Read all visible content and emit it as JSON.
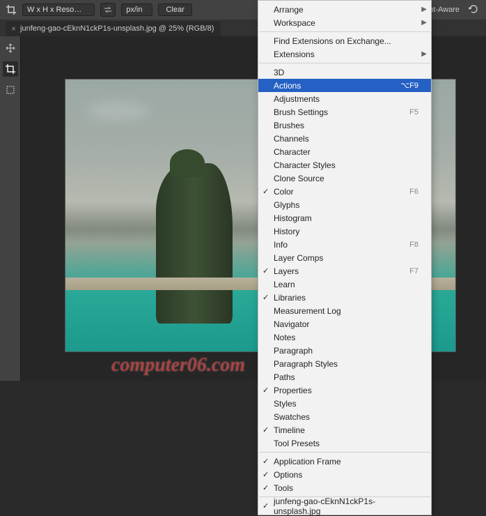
{
  "toolbar": {
    "preset": "W x H x Reso…",
    "units": "px/in",
    "clear": "Clear",
    "content_aware": "ontent-Aware"
  },
  "tab": {
    "title": "junfeng-gao-cEknN1ckP1s-unsplash.jpg @ 25% (RGB/8)"
  },
  "menu": {
    "groups": [
      [
        {
          "label": "Arrange",
          "submenu": true
        },
        {
          "label": "Workspace",
          "submenu": true
        }
      ],
      [
        {
          "label": "Find Extensions on Exchange..."
        },
        {
          "label": "Extensions",
          "submenu": true
        }
      ],
      [
        {
          "label": "3D"
        },
        {
          "label": "Actions",
          "shortcut": "⌥F9",
          "highlight": true
        },
        {
          "label": "Adjustments"
        },
        {
          "label": "Brush Settings",
          "shortcut": "F5"
        },
        {
          "label": "Brushes"
        },
        {
          "label": "Channels"
        },
        {
          "label": "Character"
        },
        {
          "label": "Character Styles"
        },
        {
          "label": "Clone Source"
        },
        {
          "label": "Color",
          "checked": true,
          "shortcut": "F6"
        },
        {
          "label": "Glyphs"
        },
        {
          "label": "Histogram"
        },
        {
          "label": "History"
        },
        {
          "label": "Info",
          "shortcut": "F8"
        },
        {
          "label": "Layer Comps"
        },
        {
          "label": "Layers",
          "checked": true,
          "shortcut": "F7"
        },
        {
          "label": "Learn"
        },
        {
          "label": "Libraries",
          "checked": true
        },
        {
          "label": "Measurement Log"
        },
        {
          "label": "Navigator"
        },
        {
          "label": "Notes"
        },
        {
          "label": "Paragraph"
        },
        {
          "label": "Paragraph Styles"
        },
        {
          "label": "Paths"
        },
        {
          "label": "Properties",
          "checked": true
        },
        {
          "label": "Styles"
        },
        {
          "label": "Swatches"
        },
        {
          "label": "Timeline",
          "checked": true
        },
        {
          "label": "Tool Presets"
        }
      ],
      [
        {
          "label": "Application Frame",
          "checked": true
        },
        {
          "label": "Options",
          "checked": true
        },
        {
          "label": "Tools",
          "checked": true
        }
      ],
      [
        {
          "label": "junfeng-gao-cEknN1ckP1s-unsplash.jpg",
          "checked": true
        }
      ]
    ]
  },
  "watermark": "computer06.com"
}
